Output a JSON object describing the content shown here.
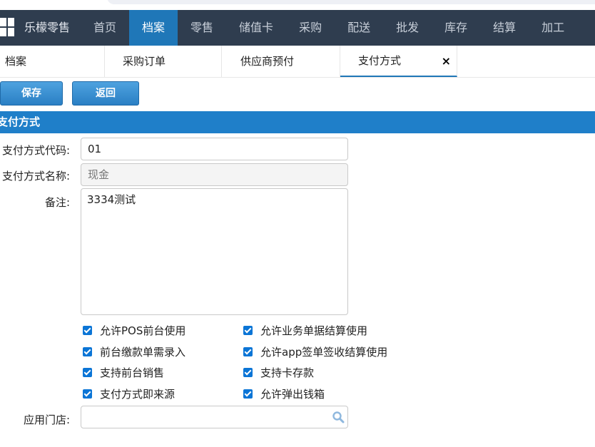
{
  "app": {
    "brand": "乐檬零售"
  },
  "nav": {
    "items": [
      "首页",
      "档案",
      "零售",
      "储值卡",
      "采购",
      "配送",
      "批发",
      "库存",
      "结算",
      "加工"
    ],
    "active_index": 1
  },
  "tabs": [
    {
      "label": "档案"
    },
    {
      "label": "采购订单"
    },
    {
      "label": "供应商预付"
    },
    {
      "label": "支付方式",
      "active": true,
      "close": "×"
    }
  ],
  "toolbar": {
    "save_label": "保存",
    "back_label": "返回"
  },
  "section": {
    "title": "支付方式"
  },
  "form": {
    "code_label": "支付方式代码:",
    "code_value": "01",
    "name_label": "支付方式名称:",
    "name_placeholder": "现金",
    "remark_label": "备注:",
    "remark_value": "3334测试",
    "store_label": "应用门店:",
    "store_value": ""
  },
  "checkboxes": [
    {
      "label": "允许POS前台使用",
      "checked": true
    },
    {
      "label": "允许业务单据结算使用",
      "checked": true
    },
    {
      "label": "前台缴款单需录入",
      "checked": true
    },
    {
      "label": "允许app签单签收结算使用",
      "checked": true
    },
    {
      "label": "支持前台销售",
      "checked": true
    },
    {
      "label": "支持卡存款",
      "checked": true
    },
    {
      "label": "支付方式即来源",
      "checked": true
    },
    {
      "label": "允许弹出钱箱",
      "checked": true
    }
  ],
  "colors": {
    "nav_bg": "#2f3d4f",
    "accent": "#1f77b8",
    "section_bg": "#1f7fc9",
    "checkbox": "#0b75d6"
  },
  "icons": {
    "logo": "windows-grid-icon",
    "close": "close-icon",
    "search": "search-icon"
  }
}
